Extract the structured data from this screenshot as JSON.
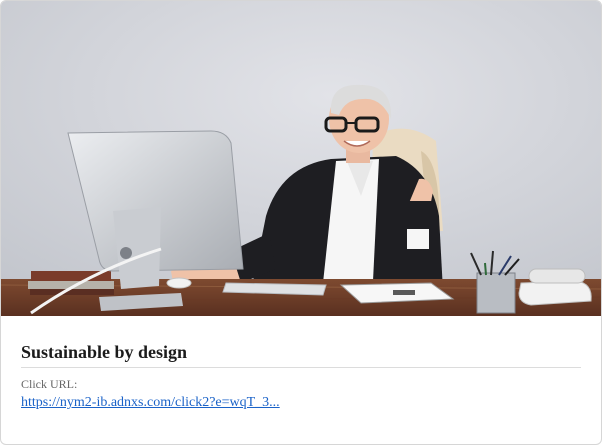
{
  "card": {
    "title": "Sustainable by design",
    "click_url_label": "Click URL:",
    "click_url": "https://nym2-ib.adnxs.com/click2?e=wqT_3..."
  },
  "colors": {
    "link": "#1a62c8",
    "title": "#1b1b1b",
    "border": "#d6d6d6"
  }
}
